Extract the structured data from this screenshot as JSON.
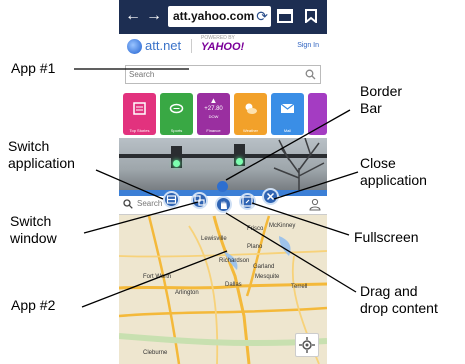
{
  "browser": {
    "url": "att.yahoo.com",
    "back_icon": "back-arrow-icon",
    "forward_icon": "forward-arrow-icon",
    "refresh_icon": "refresh-icon",
    "tabs_icon": "tabs-icon",
    "bookmark_icon": "bookmark-icon"
  },
  "site": {
    "logo": "att.net",
    "yahoo_powered": "POWERED BY",
    "yahoo_logo": "YAHOO!",
    "signin": "Sign In",
    "search_placeholder": "Search"
  },
  "tiles": [
    {
      "label": "Top Stories",
      "color": "#e2327e"
    },
    {
      "label": "Sports",
      "color": "#39a844"
    },
    {
      "label": "Finance",
      "color": "#9a2fa0"
    },
    {
      "label": "Weather",
      "color": "#f2a12a"
    },
    {
      "label": "Mail",
      "color": "#3a8ee6"
    }
  ],
  "finance_tile": {
    "top": "+27.80",
    "bottom": "DOW"
  },
  "map": {
    "search_placeholder": "Search",
    "cities": [
      "Lewisville",
      "Frisco",
      "McKinney",
      "Plano",
      "Richardson",
      "Garland",
      "Fort Worth",
      "Dallas",
      "Mesquite",
      "Arlington",
      "Terrell",
      "Cleburne"
    ]
  },
  "callouts": {
    "app1": "App #1",
    "switch_application": [
      "Switch",
      "application"
    ],
    "switch_window": [
      "Switch",
      "window"
    ],
    "app2": "App #2",
    "border_bar": [
      "Border",
      "Bar"
    ],
    "close_application": [
      "Close",
      "application"
    ],
    "fullscreen": "Fullscreen",
    "drag_drop": [
      "Drag and",
      "drop content"
    ]
  },
  "colors": {
    "browser_bar": "#1d2e52",
    "border_bar": "#3c7fd6",
    "control_button": "#2f64b3"
  }
}
